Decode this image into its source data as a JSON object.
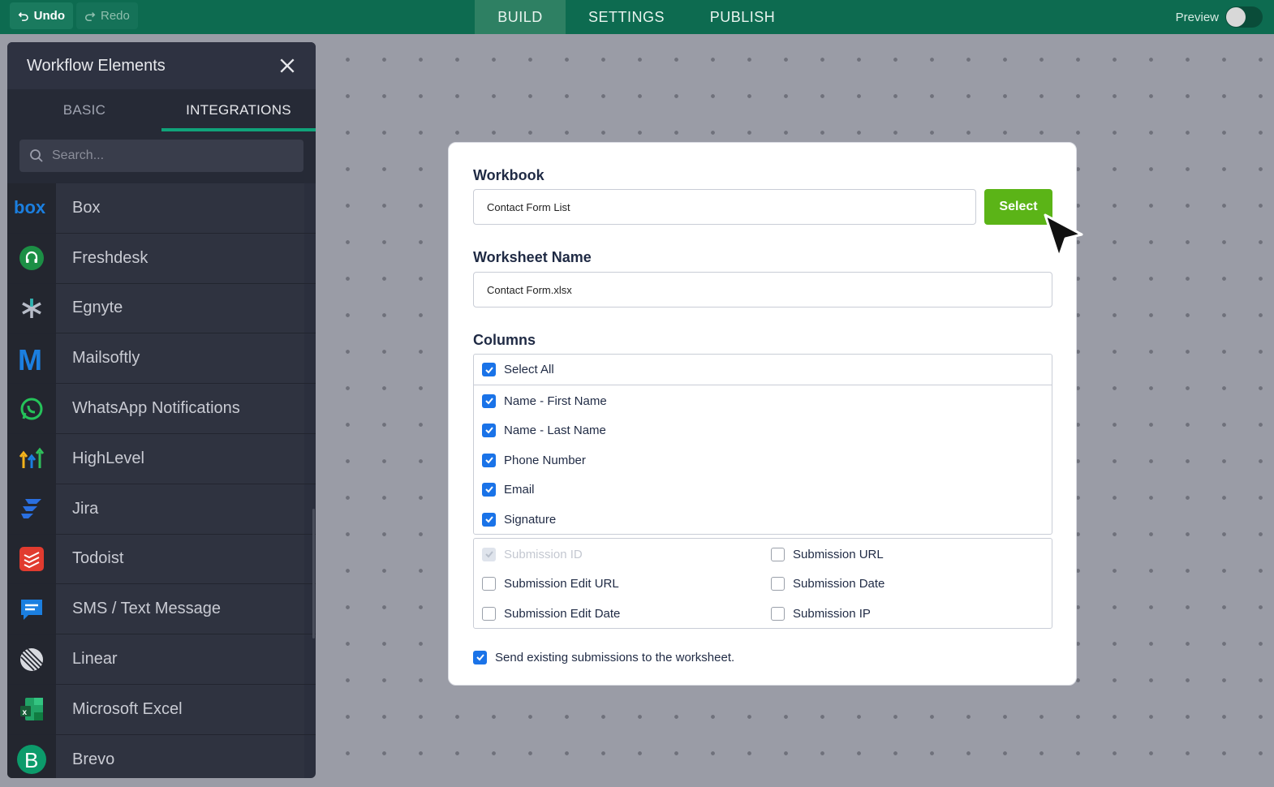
{
  "topbar": {
    "undo_label": "Undo",
    "redo_label": "Redo",
    "tabs": [
      {
        "label": "BUILD"
      },
      {
        "label": "SETTINGS"
      },
      {
        "label": "PUBLISH"
      }
    ],
    "preview_label": "Preview",
    "brand_color": "#0d6b50"
  },
  "sidebar": {
    "title": "Workflow Elements",
    "tabs": [
      {
        "label": "BASIC"
      },
      {
        "label": "INTEGRATIONS"
      }
    ],
    "search_placeholder": "Search...",
    "items": [
      {
        "label": "Box",
        "icon": "box-icon"
      },
      {
        "label": "Freshdesk",
        "icon": "freshdesk-icon"
      },
      {
        "label": "Egnyte",
        "icon": "egnyte-icon"
      },
      {
        "label": "Mailsoftly",
        "icon": "mailsoftly-icon"
      },
      {
        "label": "WhatsApp Notifications",
        "icon": "whatsapp-icon"
      },
      {
        "label": "HighLevel",
        "icon": "highlevel-icon"
      },
      {
        "label": "Jira",
        "icon": "jira-icon"
      },
      {
        "label": "Todoist",
        "icon": "todoist-icon"
      },
      {
        "label": "SMS / Text Message",
        "icon": "sms-icon"
      },
      {
        "label": "Linear",
        "icon": "linear-icon"
      },
      {
        "label": "Microsoft Excel",
        "icon": "excel-icon"
      },
      {
        "label": "Brevo",
        "icon": "brevo-icon"
      }
    ]
  },
  "modal": {
    "workbook_label": "Workbook",
    "workbook_value": "Contact Form List",
    "select_label": "Select",
    "worksheet_label": "Worksheet Name",
    "worksheet_value": "Contact Form.xlsx",
    "columns_label": "Columns",
    "select_all_label": "Select All",
    "columns": [
      {
        "label": "Name - First Name",
        "checked": true
      },
      {
        "label": "Name - Last Name",
        "checked": true
      },
      {
        "label": "Phone Number",
        "checked": true
      },
      {
        "label": "Email",
        "checked": true
      },
      {
        "label": "Signature",
        "checked": true
      }
    ],
    "meta_columns": [
      {
        "label": "Submission ID",
        "checked": true,
        "disabled": true
      },
      {
        "label": "Submission URL",
        "checked": false
      },
      {
        "label": "Submission Edit URL",
        "checked": false
      },
      {
        "label": "Submission Date",
        "checked": false
      },
      {
        "label": "Submission Edit Date",
        "checked": false
      },
      {
        "label": "Submission IP",
        "checked": false
      }
    ],
    "send_existing_label": "Send existing submissions to the worksheet.",
    "accent_color": "#5bb417",
    "checkbox_color": "#1a73e8"
  }
}
